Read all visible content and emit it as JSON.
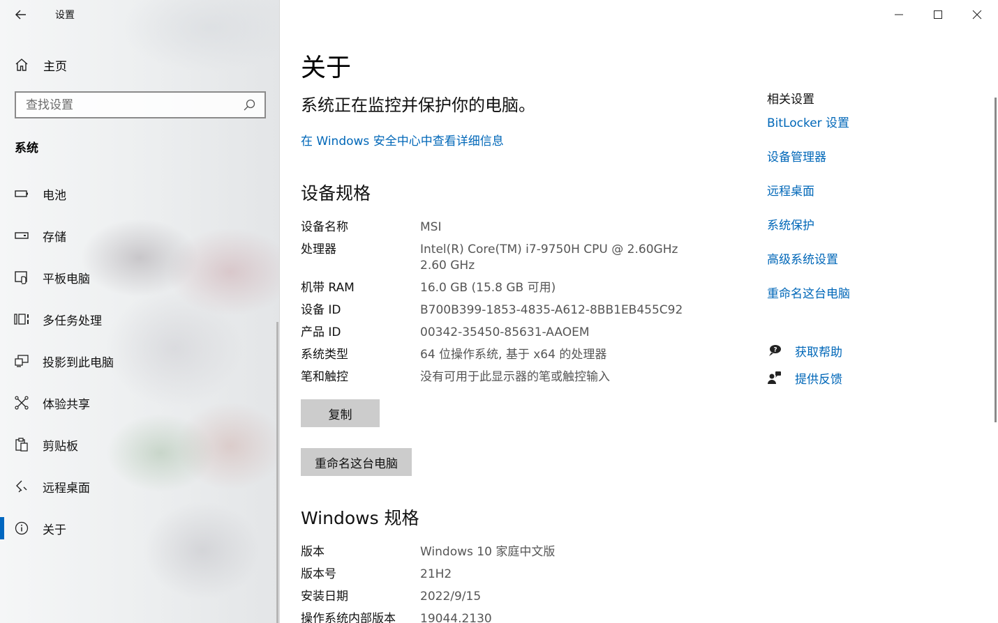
{
  "window": {
    "title": "设置",
    "minimize_icon": "minimize-icon",
    "maximize_icon": "maximize-icon",
    "close_icon": "close-icon"
  },
  "sidebar": {
    "home_label": "主页",
    "search_placeholder": "查找设置",
    "section_title": "系统",
    "items": [
      {
        "label": "电池",
        "icon": "battery-icon"
      },
      {
        "label": "存储",
        "icon": "storage-icon"
      },
      {
        "label": "平板电脑",
        "icon": "tablet-icon"
      },
      {
        "label": "多任务处理",
        "icon": "multitasking-icon"
      },
      {
        "label": "投影到此电脑",
        "icon": "projecting-icon"
      },
      {
        "label": "体验共享",
        "icon": "shared-experiences-icon"
      },
      {
        "label": "剪贴板",
        "icon": "clipboard-icon"
      },
      {
        "label": "远程桌面",
        "icon": "remote-desktop-icon"
      },
      {
        "label": "关于",
        "icon": "info-icon",
        "active": true
      }
    ]
  },
  "main": {
    "title": "关于",
    "protection_status": "系统正在监控并保护你的电脑。",
    "security_link": "在 Windows 安全中心中查看详细信息",
    "device_specs": {
      "heading": "设备规格",
      "rows": [
        {
          "k": "设备名称",
          "v": "MSI"
        },
        {
          "k": "处理器",
          "v": "Intel(R) Core(TM) i7-9750H CPU @ 2.60GHz   2.60 GHz"
        },
        {
          "k": "机带 RAM",
          "v": "16.0 GB (15.8 GB 可用)"
        },
        {
          "k": "设备 ID",
          "v": "B700B399-1853-4835-A612-8BB1EB455C92"
        },
        {
          "k": "产品 ID",
          "v": "00342-35450-85631-AAOEM"
        },
        {
          "k": "系统类型",
          "v": "64 位操作系统, 基于 x64 的处理器"
        },
        {
          "k": "笔和触控",
          "v": "没有可用于此显示器的笔或触控输入"
        }
      ],
      "copy_button": "复制",
      "rename_button": "重命名这台电脑"
    },
    "windows_specs": {
      "heading": "Windows 规格",
      "rows": [
        {
          "k": "版本",
          "v": "Windows 10 家庭中文版"
        },
        {
          "k": "版本号",
          "v": "21H2"
        },
        {
          "k": "安装日期",
          "v": "2022/9/15"
        },
        {
          "k": "操作系统内部版本",
          "v": "19044.2130"
        }
      ]
    }
  },
  "related": {
    "title": "相关设置",
    "links": [
      "BitLocker 设置",
      "设备管理器",
      "远程桌面",
      "系统保护",
      "高级系统设置",
      "重命名这台电脑"
    ],
    "help_label": "获取帮助",
    "feedback_label": "提供反馈"
  },
  "colors": {
    "accent": "#0067c0",
    "link": "#0067b8",
    "button_bg": "#cccccc"
  }
}
